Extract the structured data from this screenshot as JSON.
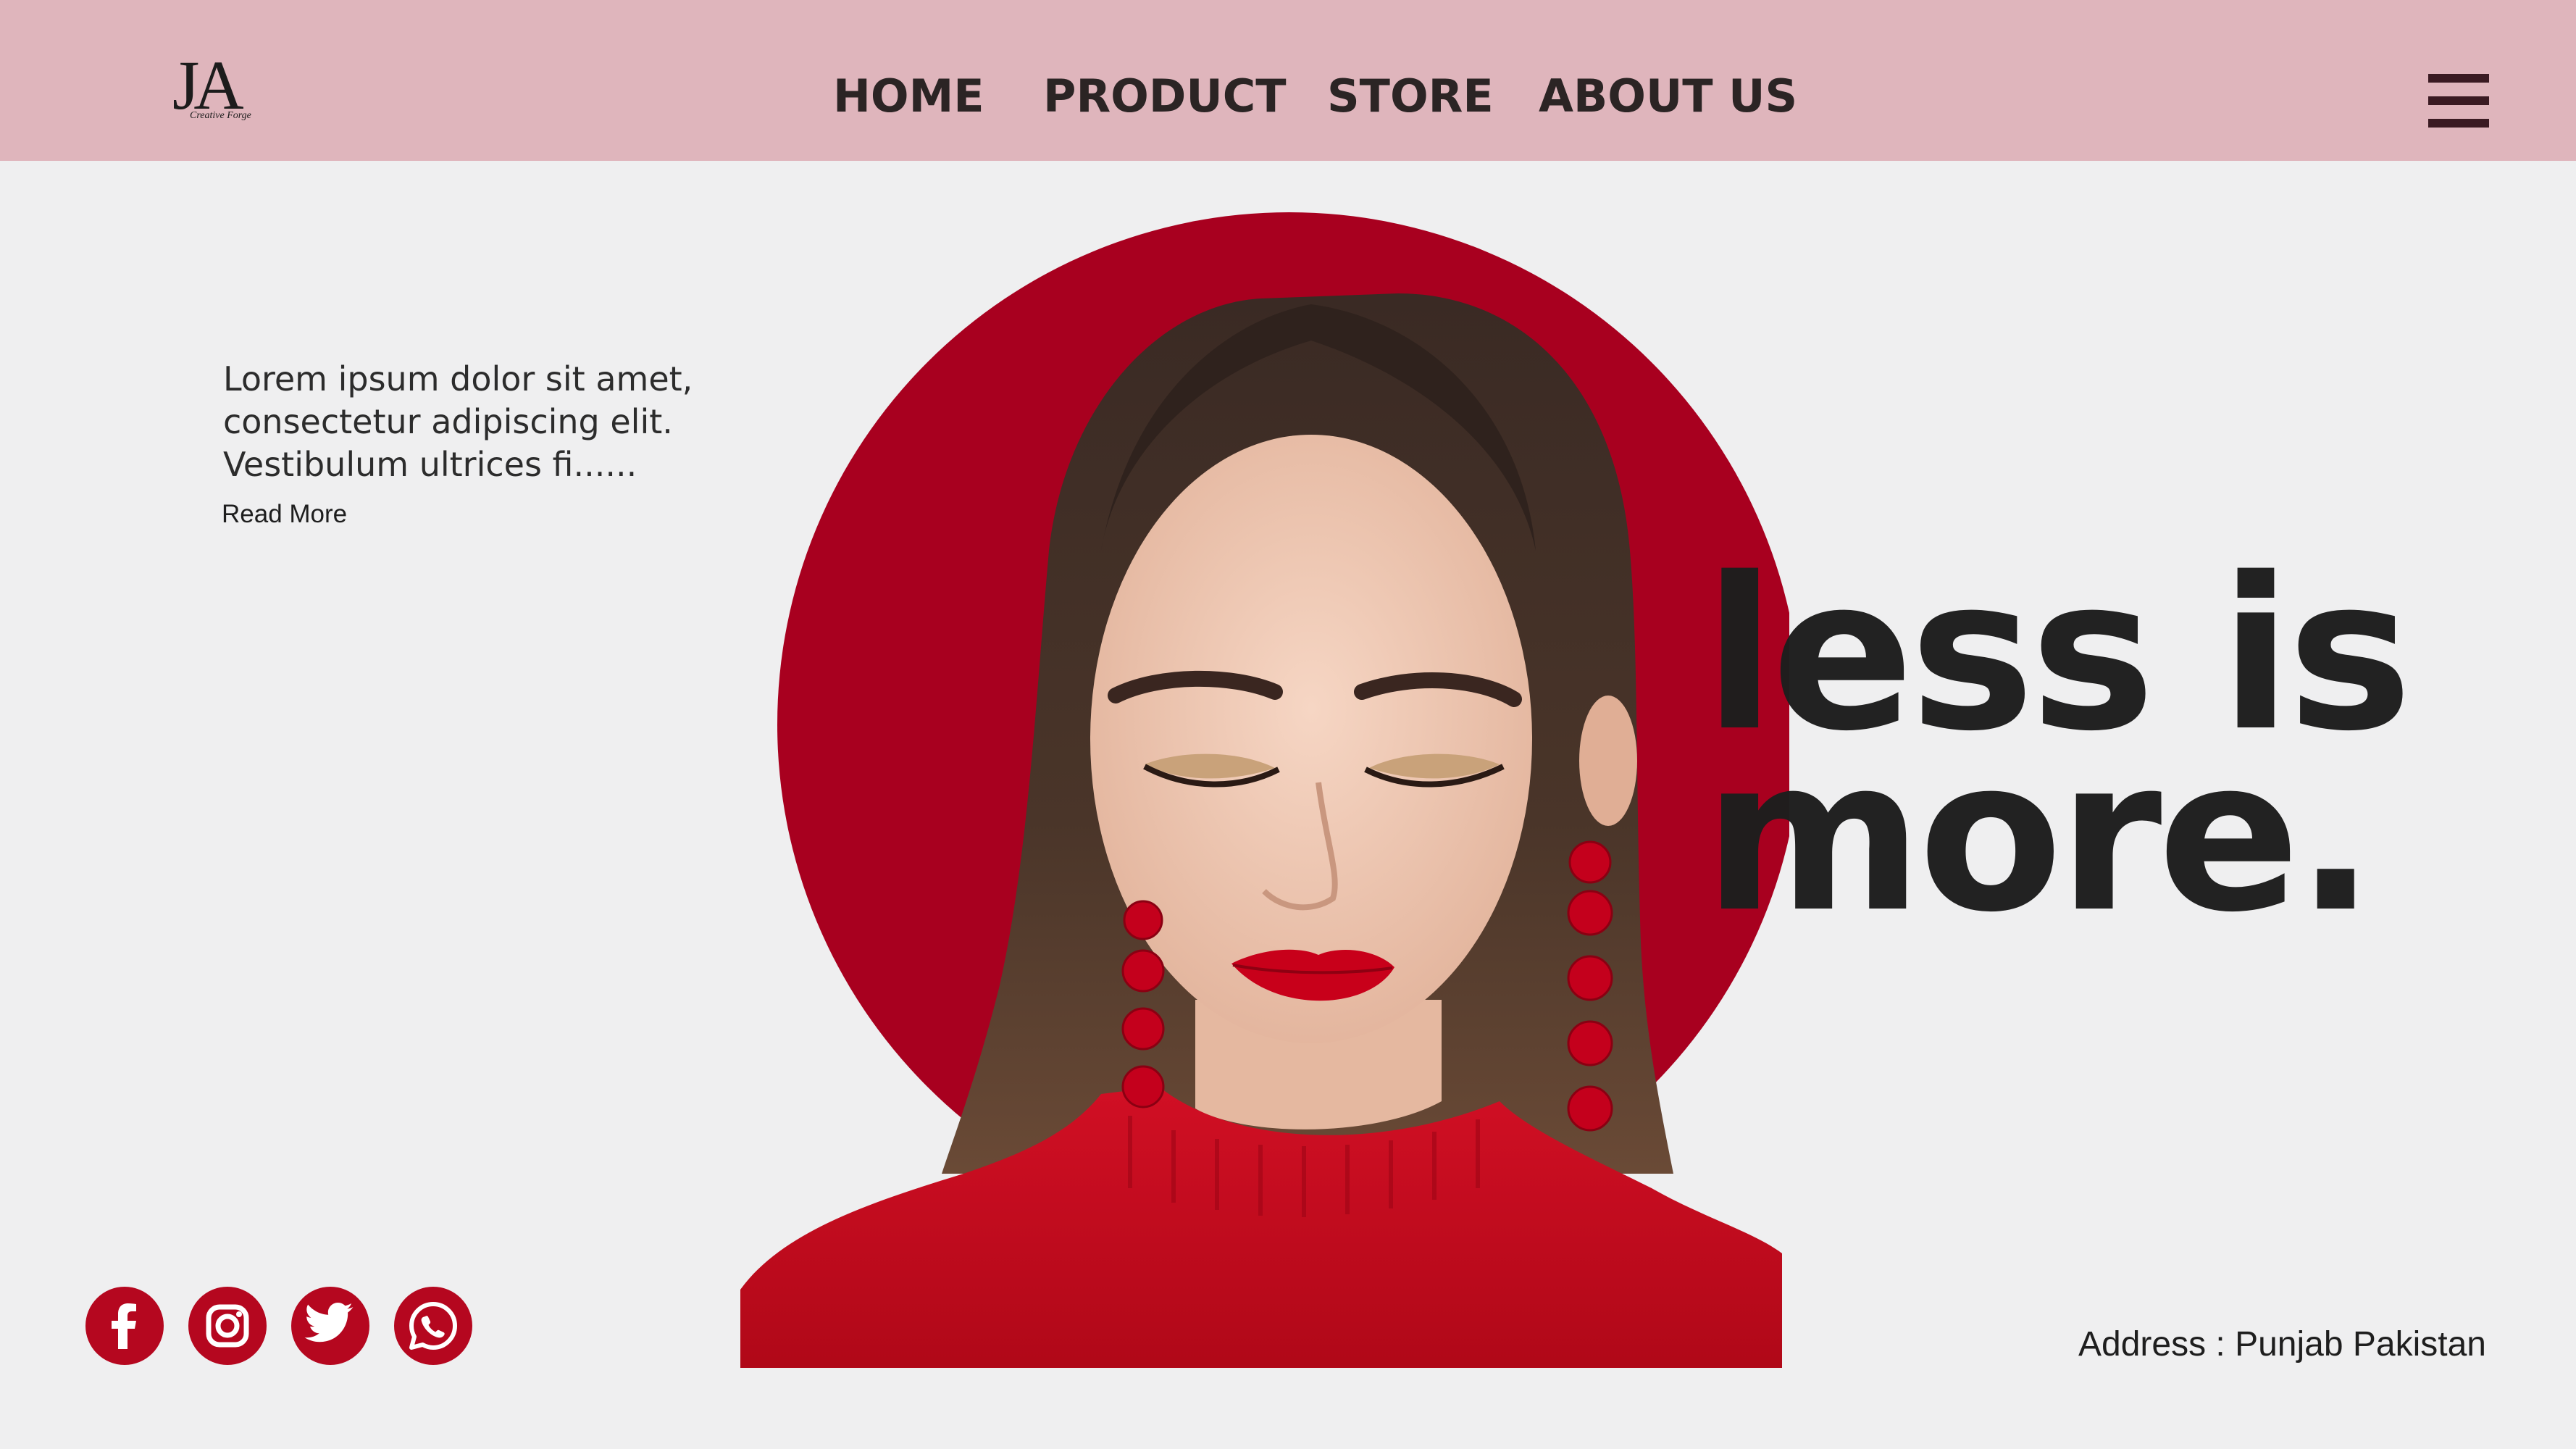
{
  "header": {
    "logo": {
      "monogram": "JA",
      "tagline": "Creative Forge"
    },
    "nav": [
      "HOME",
      "PRODUCT",
      "STORE",
      "ABOUT US"
    ]
  },
  "intro": {
    "lines": [
      "Lorem ipsum dolor sit amet,",
      "consectetur adipiscing elit.",
      "Vestibulum ultrices fi......"
    ],
    "read_more": "Read More"
  },
  "headline": {
    "line1": "less is",
    "line2": "more."
  },
  "socials": [
    "facebook-icon",
    "instagram-icon",
    "twitter-icon",
    "whatsapp-icon"
  ],
  "address": "Address : Punjab Pakistan",
  "colors": {
    "header_bg": "#dfb5bc",
    "accent_red": "#a8001f",
    "page_bg": "#efeff0",
    "text_dark": "#1e1e1e"
  }
}
